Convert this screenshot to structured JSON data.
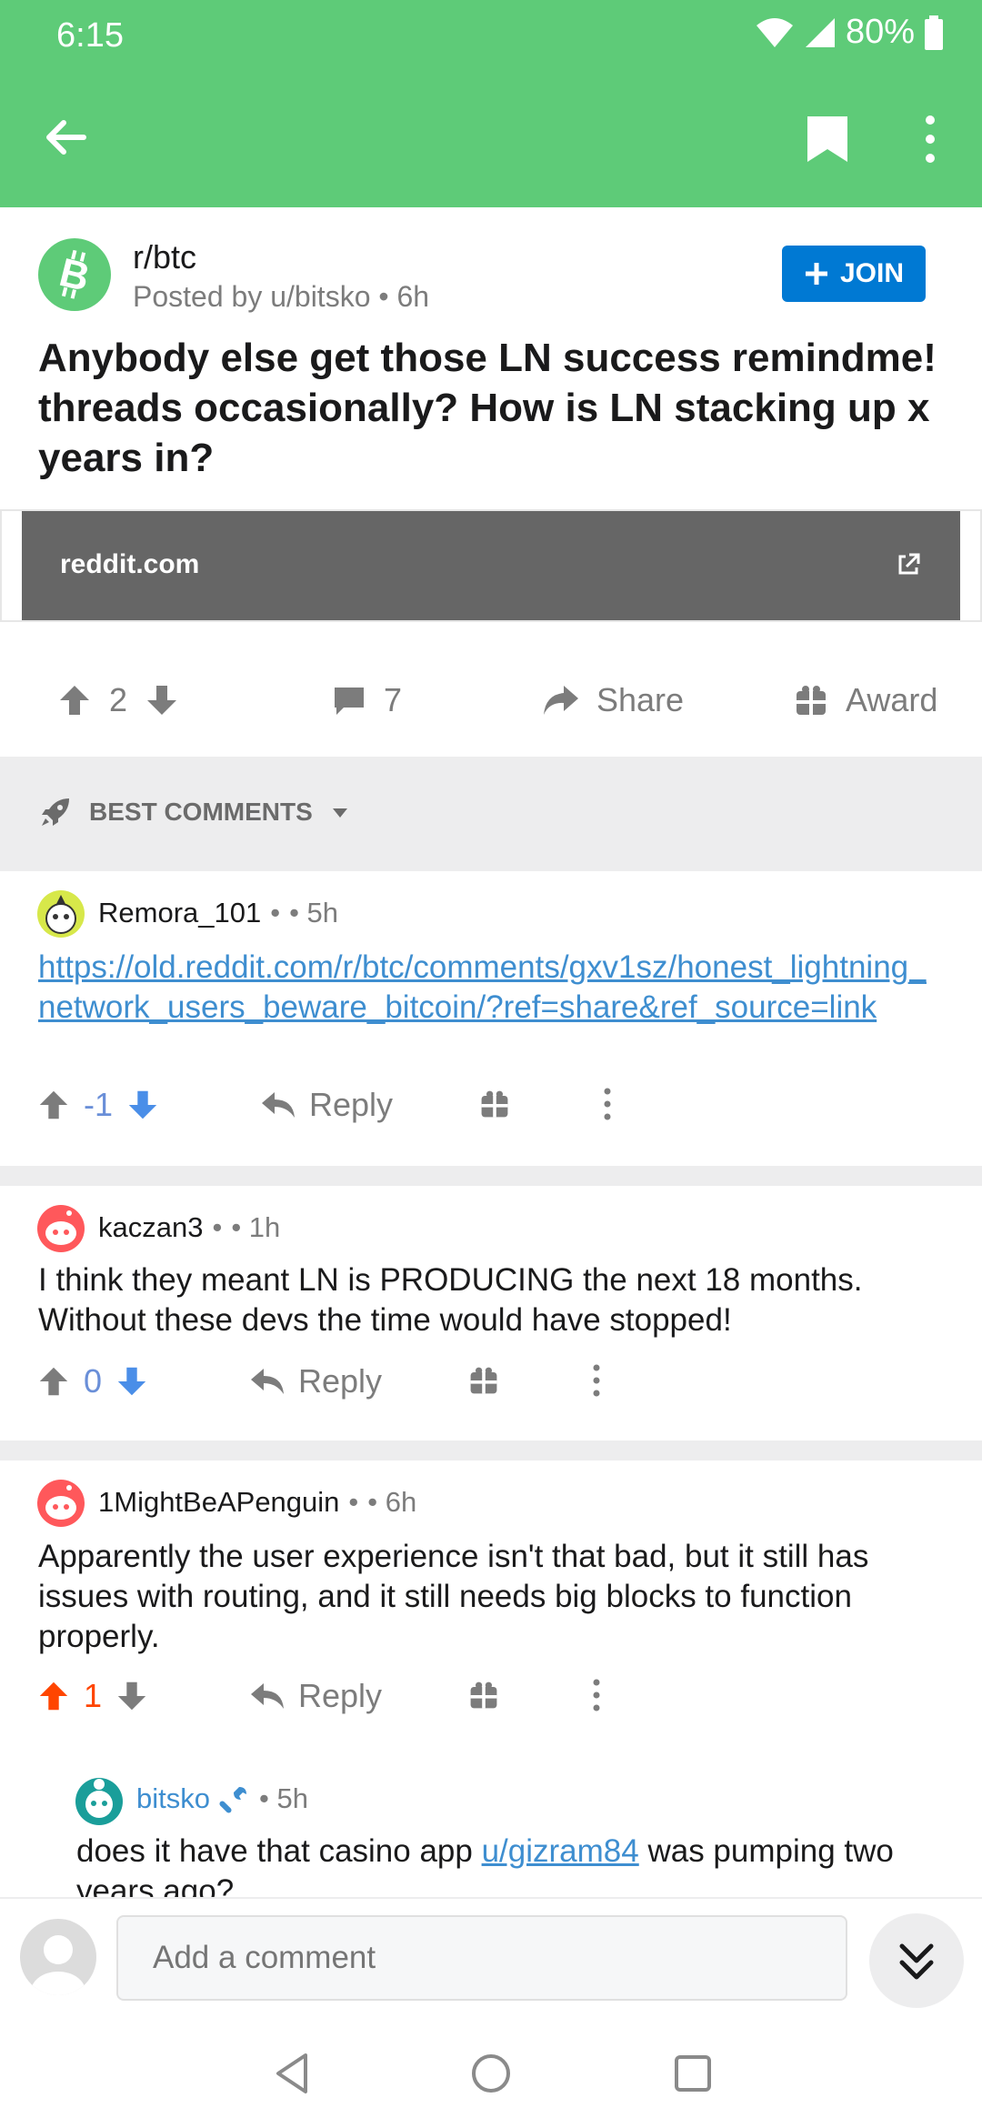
{
  "status": {
    "time": "6:15",
    "battery": "80%"
  },
  "appbar": {
    "back_icon": "arrow-left-icon",
    "bookmark_icon": "bookmark-icon",
    "more_icon": "more-vertical-icon"
  },
  "post": {
    "subreddit": "r/btc",
    "posted_by": "Posted by u/bitsko",
    "age": "6h",
    "join_label": "JOIN",
    "title": "Anybody else get those LN success remindme! threads occasionally? How is LN stacking up x years in?",
    "link_domain": "reddit.com",
    "votes": "2",
    "comments": "7",
    "share_label": "Share",
    "award_label": "Award",
    "brand_color": "#5ecb78"
  },
  "sort": {
    "label": "BEST COMMENTS"
  },
  "comments": [
    {
      "author": "Remora_101",
      "sep": "•",
      "age": "• 5h",
      "body": "https://old.reddit.com/r/btc/comments/gxv1sz/honest_lightning_network_users_beware_bitcoin/?ref=share&ref_source=link",
      "score": "-1",
      "reply_label": "Reply"
    },
    {
      "author": "kaczan3",
      "sep": "•",
      "age": "• 1h",
      "body": "I think they meant LN is PRODUCING the next 18 months. Without these devs the time would have stopped!",
      "score": "0",
      "reply_label": "Reply"
    },
    {
      "author": "1MightBeAPenguin",
      "sep": "•",
      "age": "• 6h",
      "body": "Apparently the user experience isn't that bad, but it still has issues with routing, and it still needs big blocks to function properly.",
      "score": "1",
      "reply_label": "Reply"
    },
    {
      "author": "bitsko",
      "age": "• 5h",
      "body_prefix": "does it have that casino app ",
      "body_link": "u/gizram84",
      "body_suffix": " was pumping two years ago?"
    }
  ],
  "composer": {
    "placeholder": "Add a comment"
  }
}
